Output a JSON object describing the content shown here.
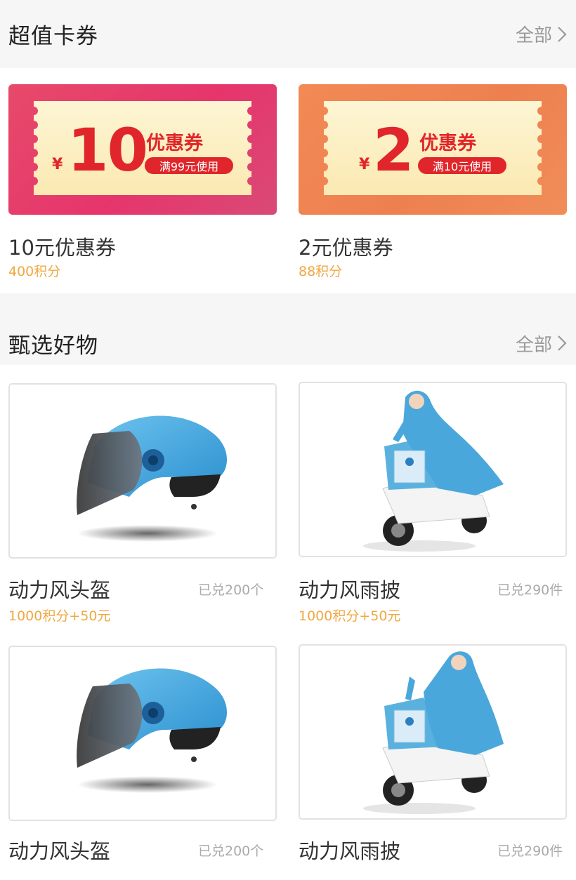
{
  "coupons_section": {
    "title": "超值卡券",
    "more_label": "全部",
    "items": [
      {
        "amount": "10",
        "currency": "¥",
        "type_label": "优惠券",
        "condition": "满99元使用",
        "name": "10元优惠券",
        "points": "400积分"
      },
      {
        "amount": "2",
        "currency": "¥",
        "type_label": "优惠券",
        "condition": "满10元使用",
        "name": "2元优惠券",
        "points": "88积分"
      }
    ]
  },
  "products_section": {
    "title": "甄选好物",
    "more_label": "全部",
    "items": [
      {
        "name": "动力风头盔",
        "sold": "已兑200个",
        "price": "1000积分+50元",
        "image": "helmet-image"
      },
      {
        "name": "动力风雨披",
        "sold": "已兑290件",
        "price": "1000积分+50元",
        "image": "raincoat-image"
      },
      {
        "name": "动力风头盔",
        "sold": "已兑200个",
        "price": "",
        "image": "helmet-image"
      },
      {
        "name": "动力风雨披",
        "sold": "已兑290件",
        "price": "",
        "image": "raincoat-image"
      }
    ]
  },
  "colors": {
    "coupon_pink": "#e6356c",
    "coupon_orange": "#ee8050",
    "ticket_cream": "#fdf1c9",
    "coupon_red": "#e0262a",
    "points_orange": "#f0a841"
  }
}
